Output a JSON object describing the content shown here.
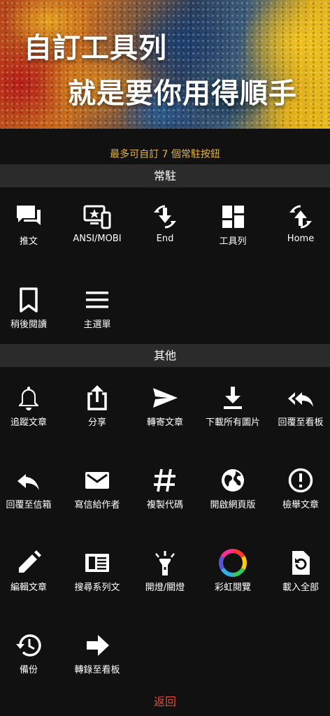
{
  "hero": {
    "line1": "自訂工具列",
    "line2": "就是要你用得順手"
  },
  "limit_note": "最多可自訂 7 個常駐按鈕",
  "sections": {
    "pinned": {
      "title": "常駐"
    },
    "other": {
      "title": "其他"
    }
  },
  "pinned_items": [
    {
      "label": "推文",
      "icon": "comment-icon"
    },
    {
      "label": "ANSI/MOBI",
      "icon": "desktop-mobile-icon"
    },
    {
      "label": "End",
      "icon": "scroll-end-icon"
    },
    {
      "label": "工具列",
      "icon": "dashboard-icon"
    },
    {
      "label": "Home",
      "icon": "scroll-home-icon"
    },
    {
      "label": "稍後閱讀",
      "icon": "bookmark-icon"
    },
    {
      "label": "主選單",
      "icon": "menu-icon"
    }
  ],
  "other_items": [
    {
      "label": "追蹤文章",
      "icon": "bell-icon"
    },
    {
      "label": "分享",
      "icon": "share-icon"
    },
    {
      "label": "轉寄文章",
      "icon": "send-icon"
    },
    {
      "label": "下載所有圖片",
      "icon": "download-icon"
    },
    {
      "label": "回覆至看板",
      "icon": "reply-all-icon"
    },
    {
      "label": "回覆至信箱",
      "icon": "reply-icon"
    },
    {
      "label": "寫信給作者",
      "icon": "mail-icon"
    },
    {
      "label": "複製代碼",
      "icon": "hashtag-icon"
    },
    {
      "label": "開啟網頁版",
      "icon": "globe-icon"
    },
    {
      "label": "檢舉文章",
      "icon": "alert-icon"
    },
    {
      "label": "編輯文章",
      "icon": "pencil-icon"
    },
    {
      "label": "搜尋系列文",
      "icon": "article-icon"
    },
    {
      "label": "開燈/關燈",
      "icon": "flashlight-icon"
    },
    {
      "label": "彩虹閱覽",
      "icon": "rainbow-ring-icon"
    },
    {
      "label": "載入全部",
      "icon": "reload-file-icon"
    },
    {
      "label": "備份",
      "icon": "history-icon"
    },
    {
      "label": "轉錄至看板",
      "icon": "arrow-right-icon"
    }
  ],
  "back_label": "返回"
}
